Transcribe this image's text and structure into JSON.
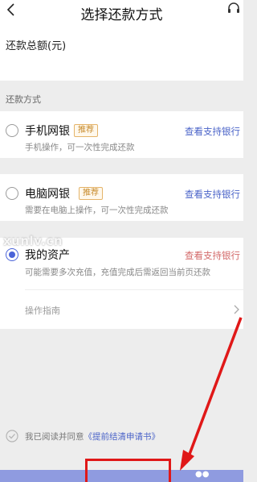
{
  "header": {
    "title": "选择还款方式",
    "back_icon": "chevron-left-icon",
    "service_icon": "headset-icon"
  },
  "amount": {
    "label": "还款总额(元)"
  },
  "section": {
    "title": "还款方式"
  },
  "options": [
    {
      "name": "手机网银",
      "badge": "推荐",
      "link": "查看支持银行",
      "desc": "手机操作，可一次性完成还款",
      "selected": false
    },
    {
      "name": "电脑网银",
      "badge": "推荐",
      "link": "查看支持银行",
      "desc": "需要在电脑上操作，可一次性完成还款",
      "selected": false
    },
    {
      "name": "我的资产",
      "link": "查看支持银行",
      "desc": "可能需要多次充值，充值完成后需返回当前页还款",
      "selected": true,
      "guide_label": "操作指南"
    }
  ],
  "watermark": "xunlv.cn",
  "agreement": {
    "text": "我已阅读并同意",
    "link": "《提前结清申请书》",
    "checked": true
  },
  "colors": {
    "accent": "#4a63d8",
    "link": "#4a63c8",
    "badge_text": "#c78a2b",
    "annotation": "#e01818",
    "bottom_bar": "#8f9be0"
  }
}
